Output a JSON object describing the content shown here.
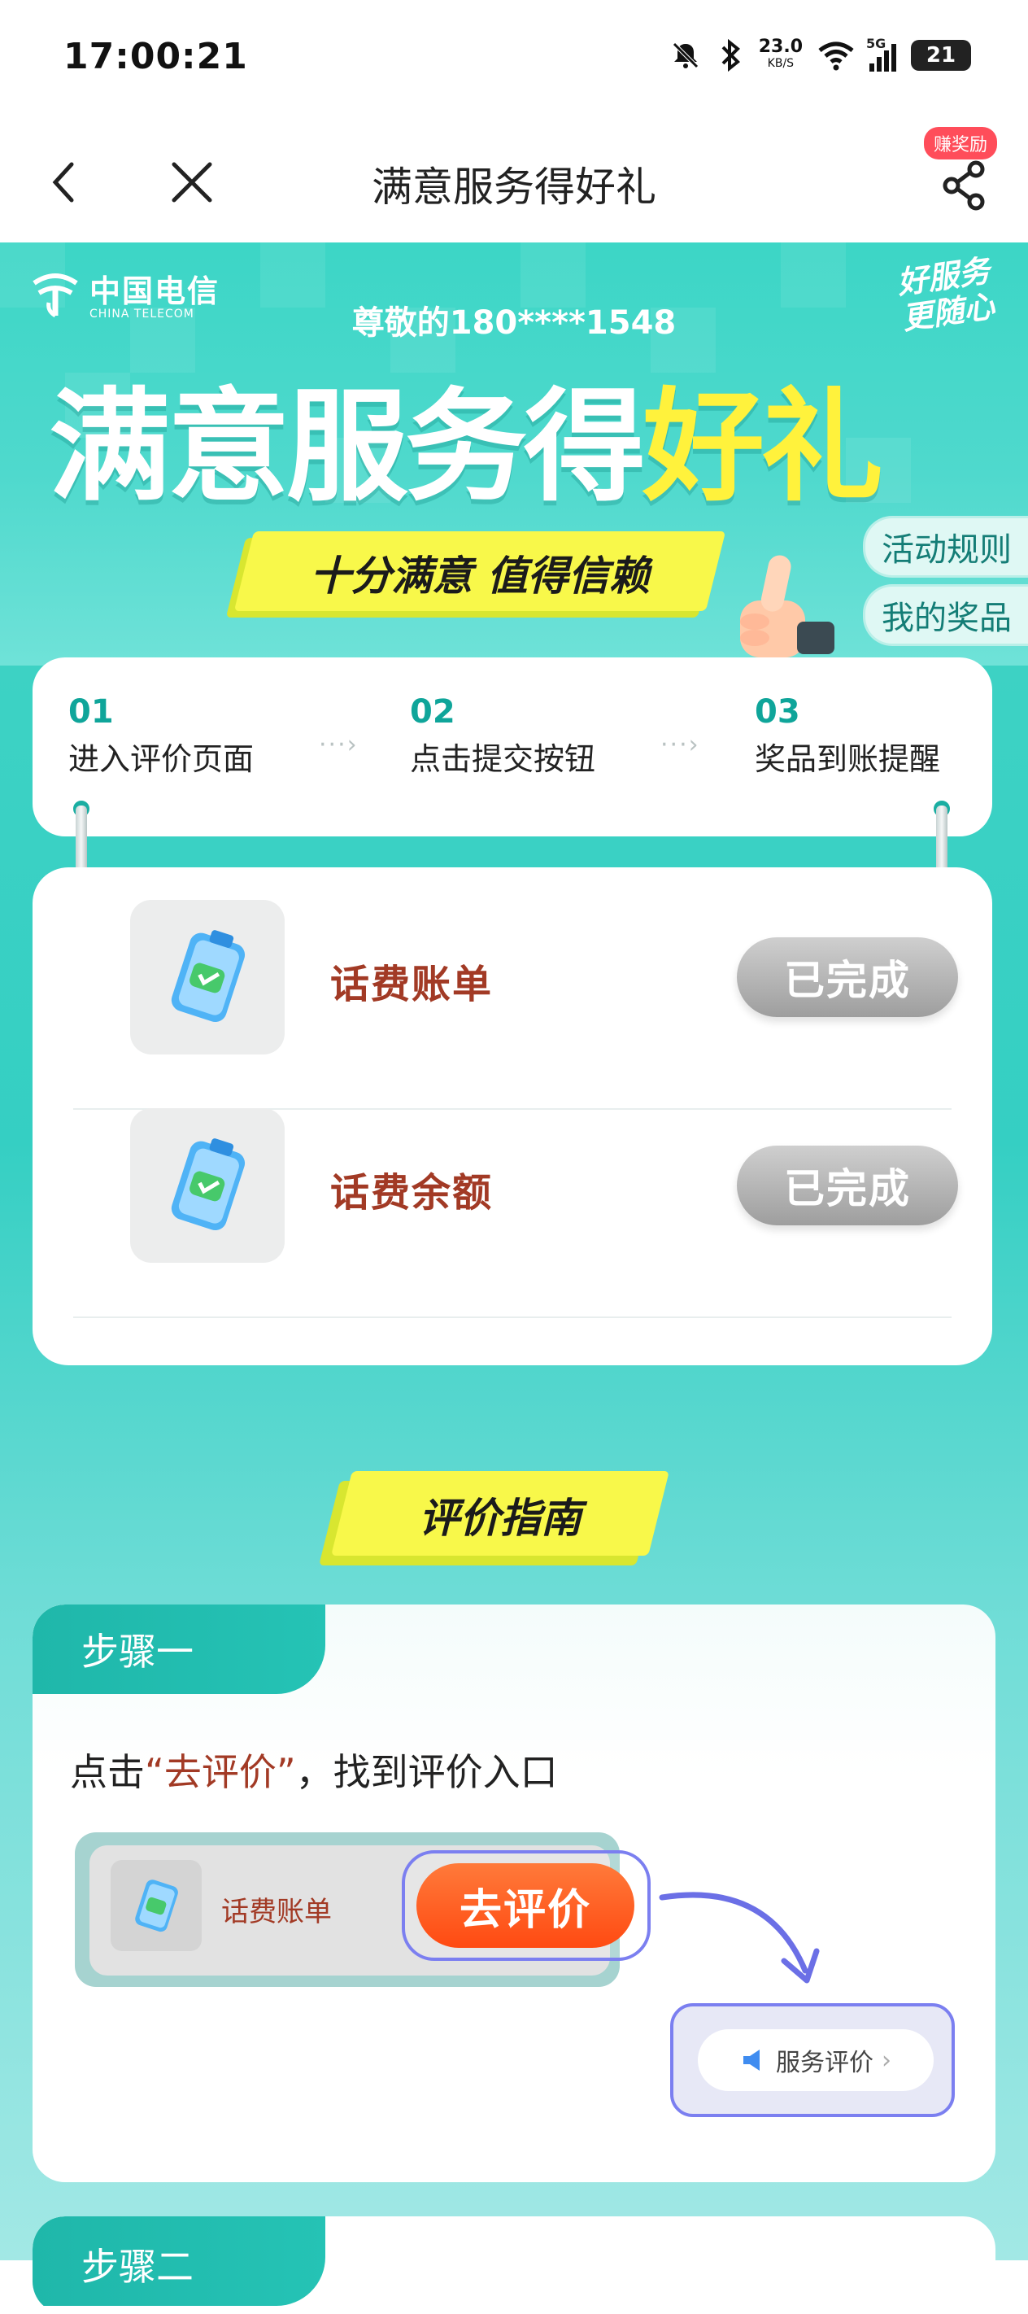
{
  "status_bar": {
    "time": "17:00:21",
    "net_speed_value": "23.0",
    "net_speed_unit": "KB/S",
    "network": "5G",
    "battery": "21"
  },
  "nav": {
    "title": "满意服务得好礼",
    "reward_badge": "赚奖励",
    "back_icon": "chevron-left-icon",
    "close_icon": "close-icon",
    "share_icon": "share-icon"
  },
  "hero": {
    "brand_cn": "中国电信",
    "brand_en": "CHINA TELECOM",
    "slogan_line1": "好服务",
    "slogan_line2": "更随心",
    "greeting": "尊敬的180****1548",
    "title_white": "满意服务得",
    "title_yellow": "好礼",
    "ribbon": "十分满意 值得信赖",
    "rules_button": "活动规则",
    "prizes_button": "我的奖品"
  },
  "steps": [
    {
      "num": "01",
      "label": "进入评价页面"
    },
    {
      "num": "02",
      "label": "点击提交按钮"
    },
    {
      "num": "03",
      "label": "奖品到账提醒"
    }
  ],
  "tasks": [
    {
      "name": "话费账单",
      "status": "已完成"
    },
    {
      "name": "话费余额",
      "status": "已完成"
    }
  ],
  "guide": {
    "heading": "评价指南",
    "step1_tab": "步骤一",
    "step1_prefix": "点击",
    "step1_highlight": "“去评价”",
    "step1_suffix": "，找到评价入口",
    "demo_task": "话费账单",
    "demo_button": "去评价",
    "demo_review": "服务评价",
    "step2_tab": "步骤二"
  },
  "colors": {
    "teal": "#3cd6c6",
    "yellow": "#f8f84a",
    "task_red": "#a23a25",
    "orange": "#ff4a12"
  }
}
